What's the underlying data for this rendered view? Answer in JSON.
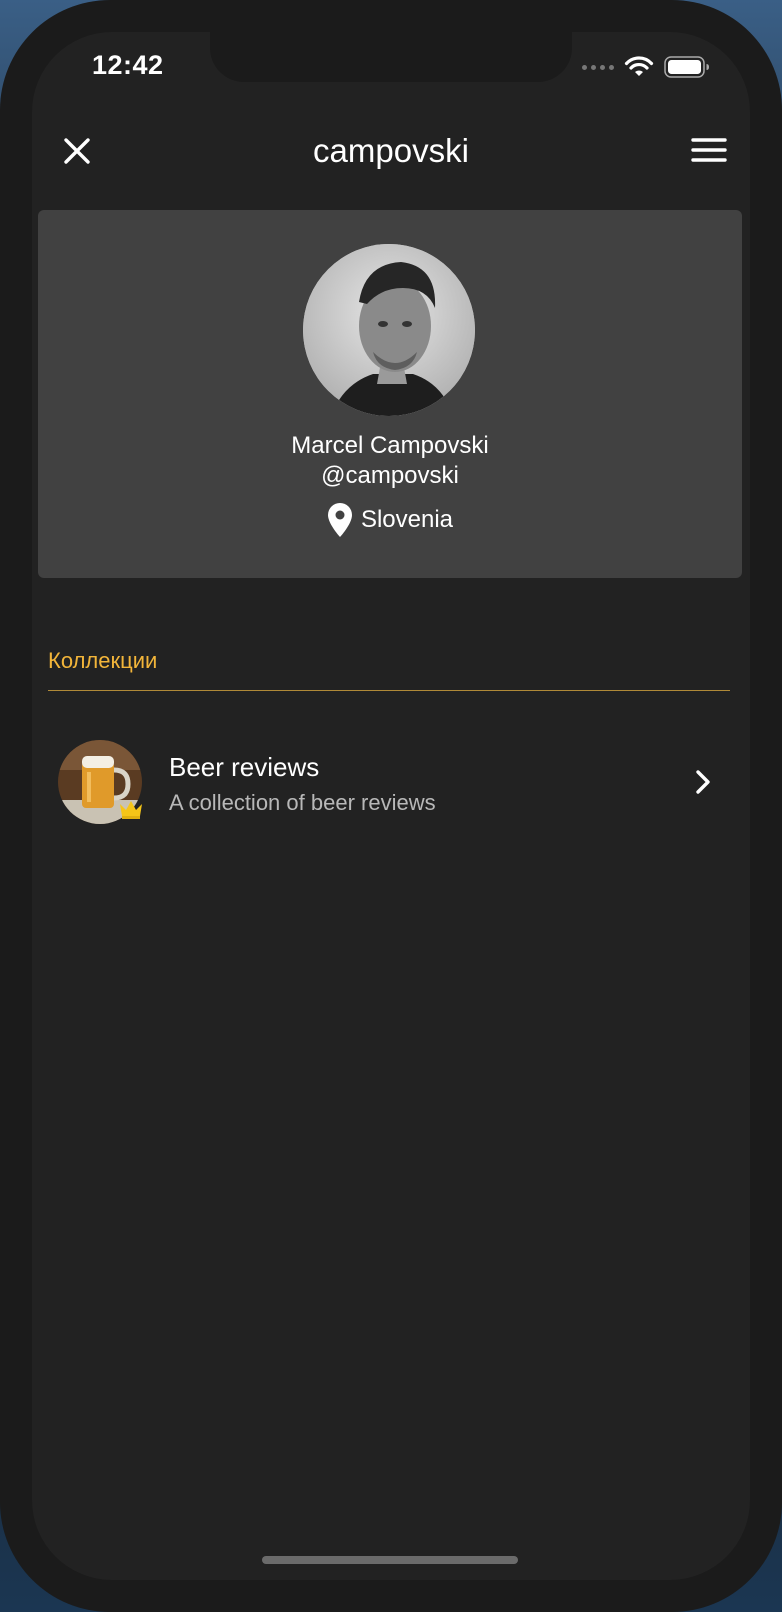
{
  "status_bar": {
    "time": "12:42",
    "icons": [
      "signal-dots-icon",
      "wifi-icon",
      "battery-icon"
    ]
  },
  "header": {
    "title": "campovski",
    "left_icon": "close-icon",
    "right_icon": "hamburger-menu-icon"
  },
  "profile": {
    "full_name": "Marcel Campovski",
    "username": "@campovski",
    "location": "Slovenia",
    "location_icon": "map-pin-icon",
    "avatar": "profile-photo"
  },
  "collections": {
    "section_title": "Коллекции",
    "accent_color": "#f2b53a",
    "items": [
      {
        "title": "Beer reviews",
        "description": "A collection of beer reviews",
        "thumbnail": "beer-mug-image",
        "badge_icon": "crown-icon",
        "trailing_icon": "chevron-right-icon"
      }
    ]
  },
  "colors": {
    "background": "#222222",
    "card": "#414141",
    "text": "#ffffff",
    "muted_text": "#b8b8b8"
  }
}
